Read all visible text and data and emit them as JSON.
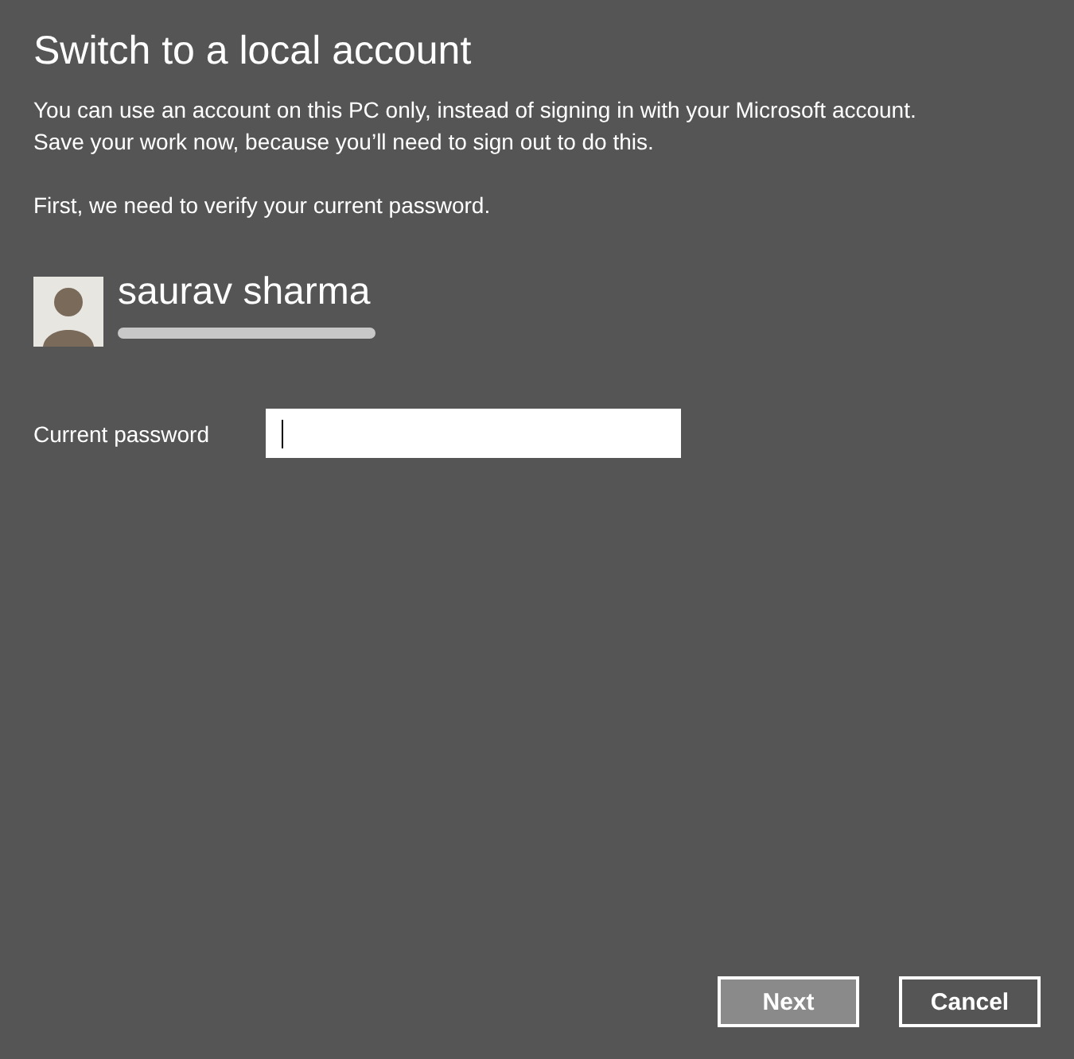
{
  "title": "Switch to a local account",
  "intro": [
    "You can use an account on this PC only, instead of signing in with your Microsoft account.",
    "Save your work now, because you’ll need to sign out to do this."
  ],
  "verify_note": "First, we need to verify your current password.",
  "account": {
    "name": "saurav sharma",
    "email_redacted": true
  },
  "password_field": {
    "label": "Current password",
    "focused": true
  },
  "buttons": [
    {
      "label": "Next",
      "disabled": true
    },
    {
      "label": "Cancel",
      "disabled": false
    }
  ]
}
